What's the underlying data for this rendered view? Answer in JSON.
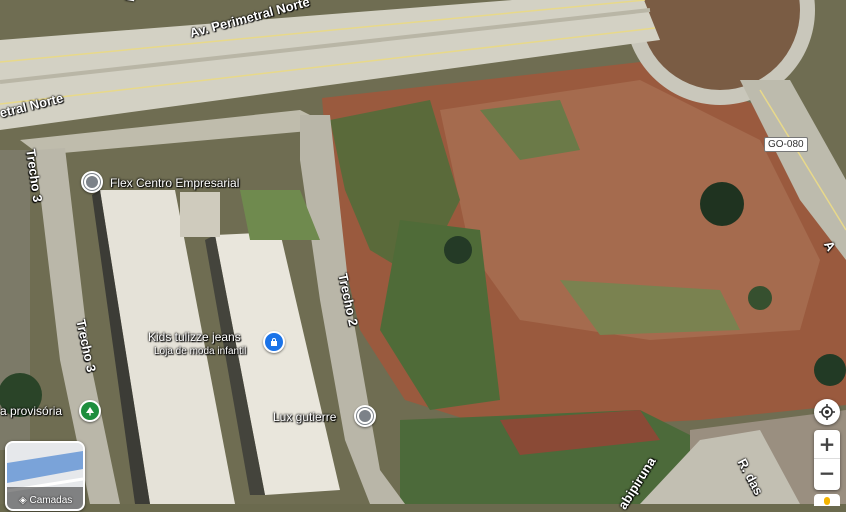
{
  "roads": {
    "avenue_top": "Av. Perimetral Norte",
    "avenue_left": "etral Norte",
    "trecho3_upper": "Trecho 3",
    "trecho3_lower": "Trecho 3",
    "trecho2": "Trecho 2",
    "highway_shield": "GO-080",
    "bottom_street_a": "abipiruna",
    "bottom_street_b": "R. das",
    "right_partial": "A",
    "top_partial": "R"
  },
  "pois": {
    "flex": {
      "name": "Flex Centro Empresarial",
      "icon": "location-pin-icon"
    },
    "kids": {
      "name": "Kids tulizze jeans",
      "subtitle": "Loja de moda infantil",
      "icon": "shopping-bag-icon"
    },
    "lux": {
      "name": "Lux gutierre",
      "icon": "location-pin-icon"
    },
    "provisoria": {
      "name": "a provisória",
      "icon": "tree-icon"
    }
  },
  "controls": {
    "layers_label": "Camadas",
    "zoom_in": "+",
    "zoom_out": "−"
  },
  "colors": {
    "poi_blue": "#1a73e8",
    "poi_green": "#1e8e3e",
    "poi_grey": "#7c8289"
  }
}
